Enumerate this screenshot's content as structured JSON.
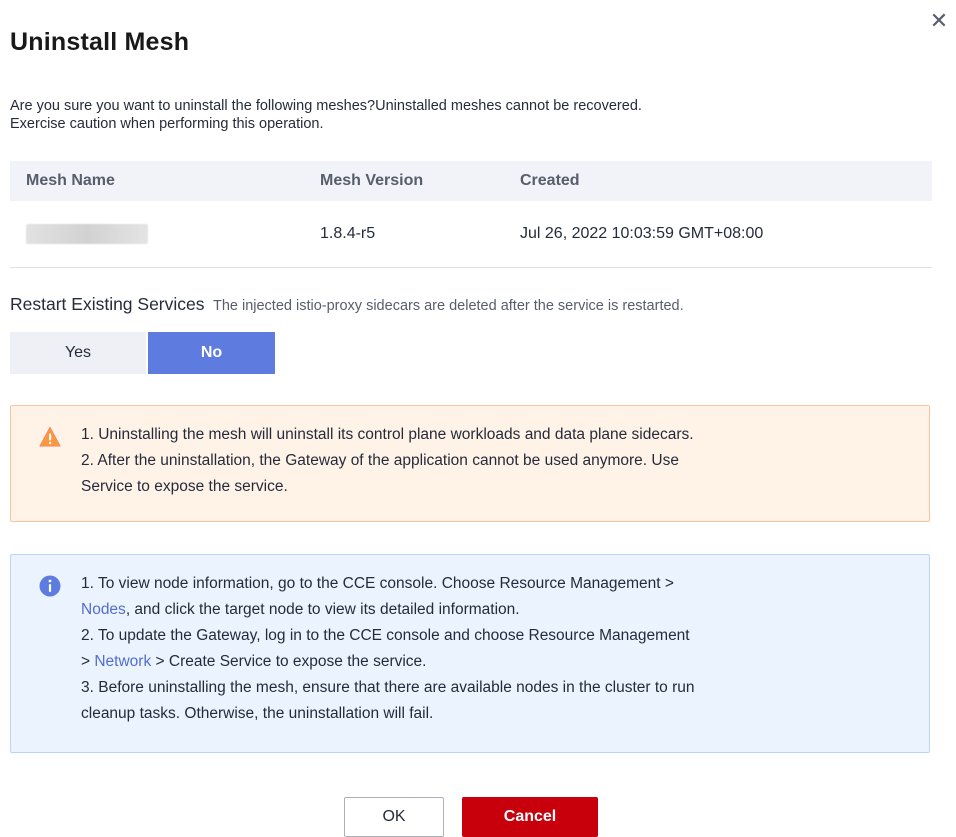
{
  "dialog": {
    "title": "Uninstall Mesh",
    "close_icon": "close-icon",
    "description_line1": "Are you sure you want to uninstall the following meshes?Uninstalled meshes cannot be recovered.",
    "description_line2": "Exercise caution when performing this operation."
  },
  "table": {
    "headers": [
      "Mesh Name",
      "Mesh Version",
      "Created"
    ],
    "rows": [
      {
        "name": "",
        "version": "1.8.4-r5",
        "created": "Jul 26, 2022 10:03:59 GMT+08:00"
      }
    ]
  },
  "restart": {
    "label": "Restart Existing Services",
    "hint": "The injected istio-proxy sidecars are deleted after the service is restarted.",
    "options": [
      "Yes",
      "No"
    ],
    "selected": "No"
  },
  "warning": {
    "icon": "warning-icon",
    "line1": "1. Uninstalling the mesh will uninstall its control plane workloads and data plane sidecars.",
    "line2": "2. After the uninstallation, the Gateway of the application cannot be used anymore. Use",
    "line3": "Service to expose the service."
  },
  "info": {
    "icon": "info-icon",
    "l1": "1. To view node information, go to the CCE console. Choose Resource Management >",
    "l2_link": "Nodes",
    "l2_rest": ", and click the target node to view its detailed information.",
    "l3": "2. To update the Gateway, log in to the CCE console and choose Resource Management",
    "l4_pre": "> ",
    "l4_link": "Network",
    "l4_rest": " > Create Service to expose the service.",
    "l5": "3. Before uninstalling the mesh, ensure that there are available nodes in the cluster to run",
    "l6": "cleanup tasks. Otherwise, the uninstallation will fail."
  },
  "buttons": {
    "ok": "OK",
    "cancel": "Cancel"
  },
  "colors": {
    "primary": "#5e7ce0",
    "danger": "#c7000b",
    "warning_bg": "#fff3e8",
    "info_bg": "#ebf3ff",
    "link": "#526ecc"
  }
}
